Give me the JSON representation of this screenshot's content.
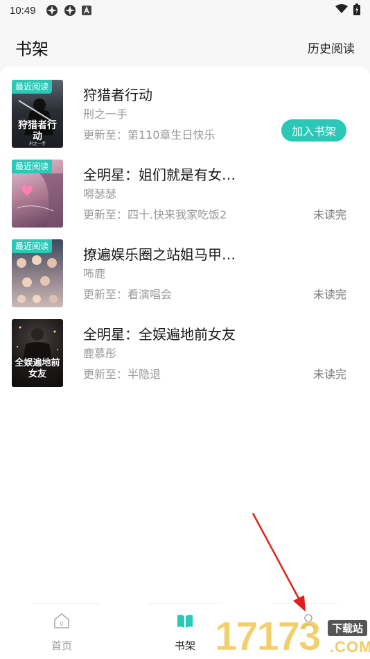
{
  "status_bar": {
    "time": "10:49",
    "icons": [
      "app-pinwheel-icon",
      "app-pinwheel-icon",
      "app-a-icon",
      "wifi-icon",
      "battery-icon"
    ]
  },
  "header": {
    "title": "书架",
    "history_label": "历史阅读"
  },
  "books": [
    {
      "badge": "最近阅读",
      "cover_text": "狩猎者行动",
      "cover_sub": "刑之一手",
      "title": "狩猎者行动",
      "author": "刑之一手",
      "update": "更新至：第110章生日快乐",
      "action_label": "加入书架"
    },
    {
      "badge": "最近阅读",
      "title": "全明星：姐们就是有女…",
      "author": "嘚瑟瑟",
      "update": "更新至：四十.快来我家吃饭2",
      "status": "未读完"
    },
    {
      "badge": "最近阅读",
      "title": "撩遍娱乐圈之站姐马甲…",
      "author": "咘鹿",
      "update": "更新至：看演唱会",
      "status": "未读完"
    },
    {
      "cover_text": "全娱遍地前女友",
      "title": "全明星：全娱遍地前女友",
      "author": "鹿慕彤",
      "update": "更新至：半隐退",
      "status": "未读完"
    }
  ],
  "bottom_nav": {
    "items": [
      {
        "label": "首页",
        "icon": "home-icon"
      },
      {
        "label": "书架",
        "icon": "open-book-icon",
        "active": true
      },
      {
        "label": "",
        "icon": "user-icon"
      }
    ]
  },
  "watermark": {
    "digits": "17173",
    "badge": "下载站",
    "com": ".COM"
  },
  "colors": {
    "accent": "#2bc8b8",
    "annotation_arrow": "#e0201b"
  }
}
